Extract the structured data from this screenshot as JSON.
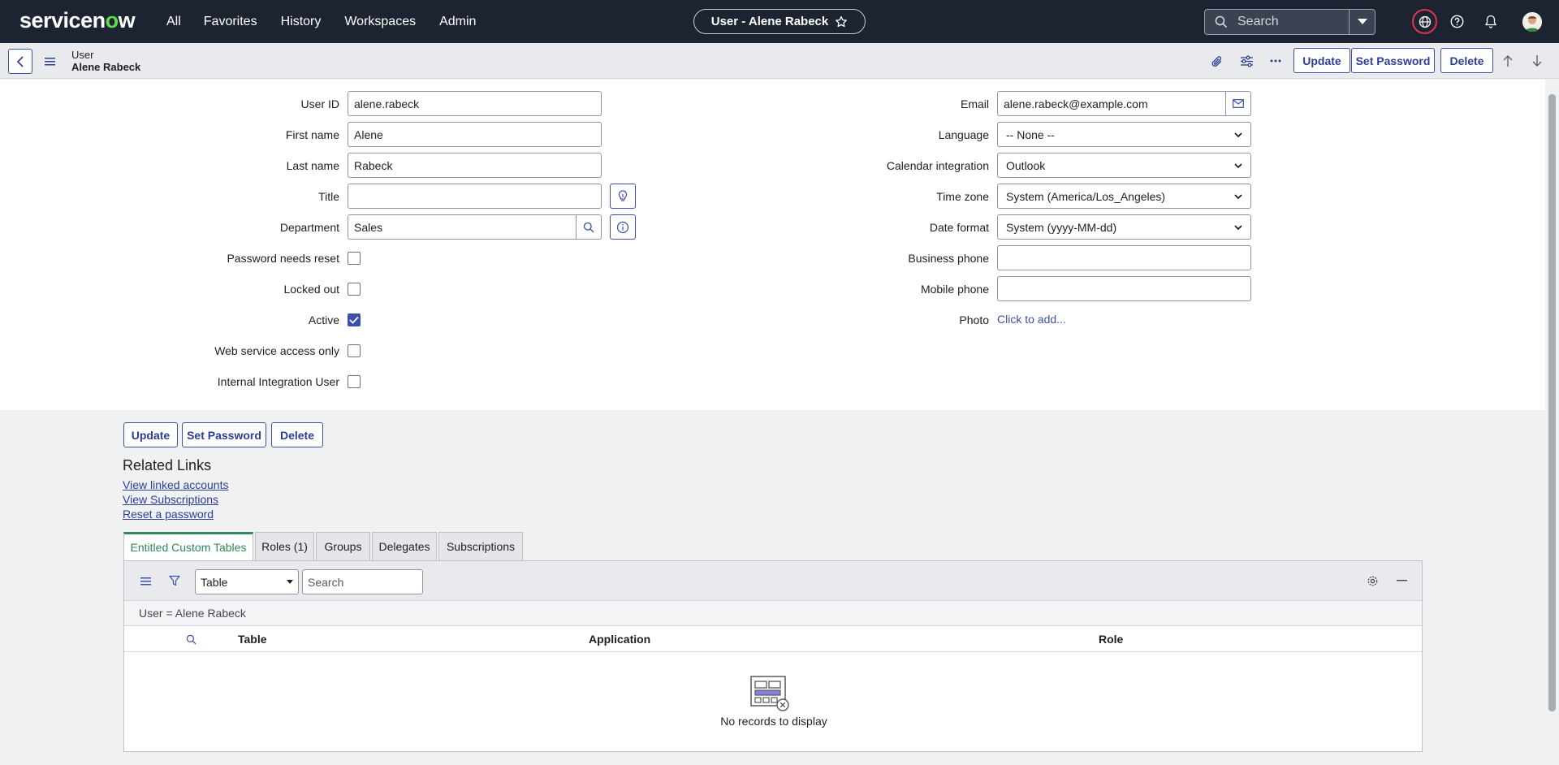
{
  "topnav": {
    "logo_main": "servicen",
    "logo_o": "o",
    "logo_end": "w",
    "links": [
      "All",
      "Favorites",
      "History",
      "Workspaces",
      "Admin"
    ],
    "record_title": "User - Alene Rabeck",
    "search_placeholder": "Search"
  },
  "header": {
    "table": "User",
    "record": "Alene Rabeck",
    "buttons": {
      "update": "Update",
      "set_password": "Set Password",
      "delete": "Delete"
    }
  },
  "form": {
    "left": {
      "user_id": {
        "label": "User ID",
        "value": "alene.rabeck"
      },
      "first_name": {
        "label": "First name",
        "value": "Alene"
      },
      "last_name": {
        "label": "Last name",
        "value": "Rabeck"
      },
      "title": {
        "label": "Title",
        "value": ""
      },
      "department": {
        "label": "Department",
        "value": "Sales"
      },
      "password_needs_reset": {
        "label": "Password needs reset",
        "checked": false
      },
      "locked_out": {
        "label": "Locked out",
        "checked": false
      },
      "active": {
        "label": "Active",
        "checked": true
      },
      "web_service_access_only": {
        "label": "Web service access only",
        "checked": false
      },
      "internal_integration_user": {
        "label": "Internal Integration User",
        "checked": false
      }
    },
    "right": {
      "email": {
        "label": "Email",
        "value": "alene.rabeck@example.com"
      },
      "language": {
        "label": "Language",
        "value": "-- None --"
      },
      "calendar_integration": {
        "label": "Calendar integration",
        "value": "Outlook"
      },
      "time_zone": {
        "label": "Time zone",
        "value": "System (America/Los_Angeles)"
      },
      "date_format": {
        "label": "Date format",
        "value": "System (yyyy-MM-dd)"
      },
      "business_phone": {
        "label": "Business phone",
        "value": ""
      },
      "mobile_phone": {
        "label": "Mobile phone",
        "value": ""
      },
      "photo": {
        "label": "Photo",
        "link": "Click to add..."
      }
    }
  },
  "bottom_buttons": {
    "update": "Update",
    "set_password": "Set Password",
    "delete": "Delete"
  },
  "related_links": {
    "title": "Related Links",
    "links": [
      "View linked accounts",
      "View Subscriptions",
      "Reset a password"
    ]
  },
  "tabs": [
    "Entitled Custom Tables",
    "Roles (1)",
    "Groups",
    "Delegates",
    "Subscriptions"
  ],
  "list": {
    "select_value": "Table",
    "search_placeholder": "Search",
    "filter": "User = Alene Rabeck",
    "columns": [
      "Table",
      "Application",
      "Role"
    ],
    "empty_message": "No records to display"
  },
  "colors": {
    "nav_bg": "#1c2331",
    "accent": "#3b50a8",
    "active_tab": "#2e8a58",
    "logo_o": "#62d84e"
  }
}
